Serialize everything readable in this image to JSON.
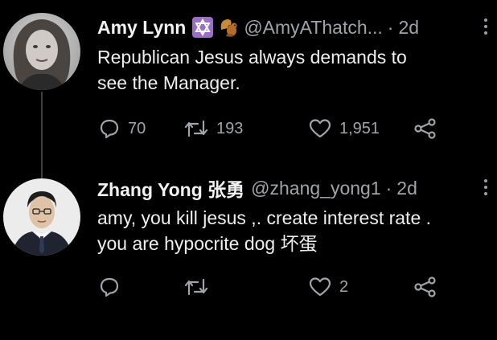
{
  "tweets": [
    {
      "display_name": "Amy Lynn",
      "handle": "@AmyAThatch...",
      "separator": "·",
      "time": "2d",
      "emojis": [
        "star-of-david-icon",
        "squirrel-icon"
      ],
      "text": "Republican Jesus always demands to\nsee the Manager.",
      "replies": "70",
      "retweets": "193",
      "likes": "1,951"
    },
    {
      "display_name": "Zhang Yong 张勇",
      "handle": "@zhang_yong1",
      "separator": "·",
      "time": "2d",
      "text": "amy, you kill jesus ,. create interest rate .\nyou are hypocrite dog 坏蛋",
      "replies": "",
      "retweets": "",
      "likes": "2"
    }
  ],
  "colors": {
    "background": "#000000",
    "text": "#eeeeee",
    "muted": "#a0a4a8",
    "thread_line": "#3a3f44"
  }
}
